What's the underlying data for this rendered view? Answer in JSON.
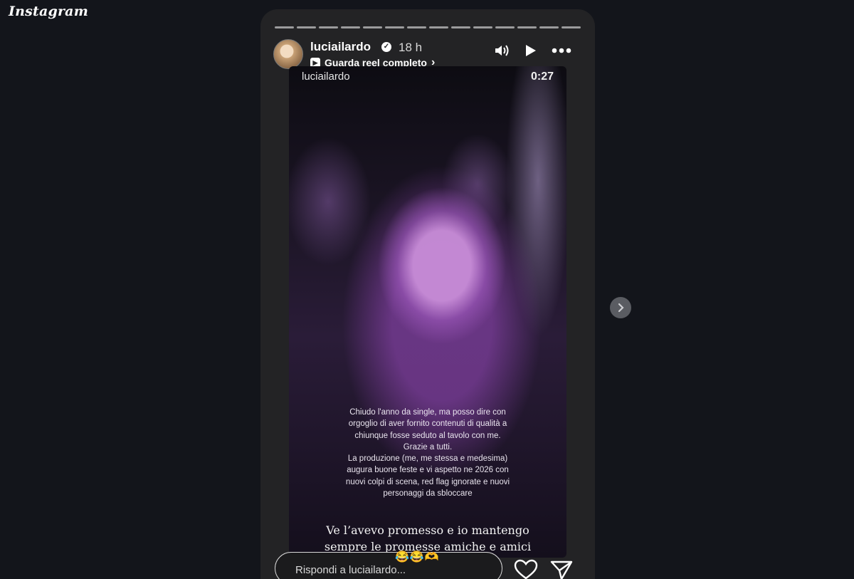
{
  "app": {
    "logo_text": "Instagram"
  },
  "story": {
    "progress_segments": 14,
    "header": {
      "username": "luciailardo",
      "time": "18 h",
      "reel_link": "Guarda reel completo"
    },
    "video": {
      "watermark_user": "luciailardo",
      "timestamp": "0:27",
      "caption": "Chiudo l'anno da single, ma posso dire con\norgoglio di aver fornito contenuti di qualità a\nchiunque fosse seduto al tavolo con me.\nGrazie a tutti.\nLa produzione (me, me stessa e medesima)\naugura buone feste e vi aspetto ne 2026 con\nnuovi colpi di scena, red flag ignorate e nuovi\npersonaggi da sbloccare"
    },
    "overlay_text": "Ve l’avevo promesso e io mantengo\nsempre le promesse amiche e amici",
    "reply": {
      "placeholder": "Rispondi a luciailardo...",
      "emojis": "😂😂🫶"
    }
  },
  "icons": {
    "verified": "verified-badge-icon",
    "reel": "reel-icon",
    "volume": "volume-icon",
    "play": "play-icon",
    "more": "more-icon",
    "heart": "heart-icon",
    "share": "share-icon",
    "next": "next-arrow-icon"
  }
}
